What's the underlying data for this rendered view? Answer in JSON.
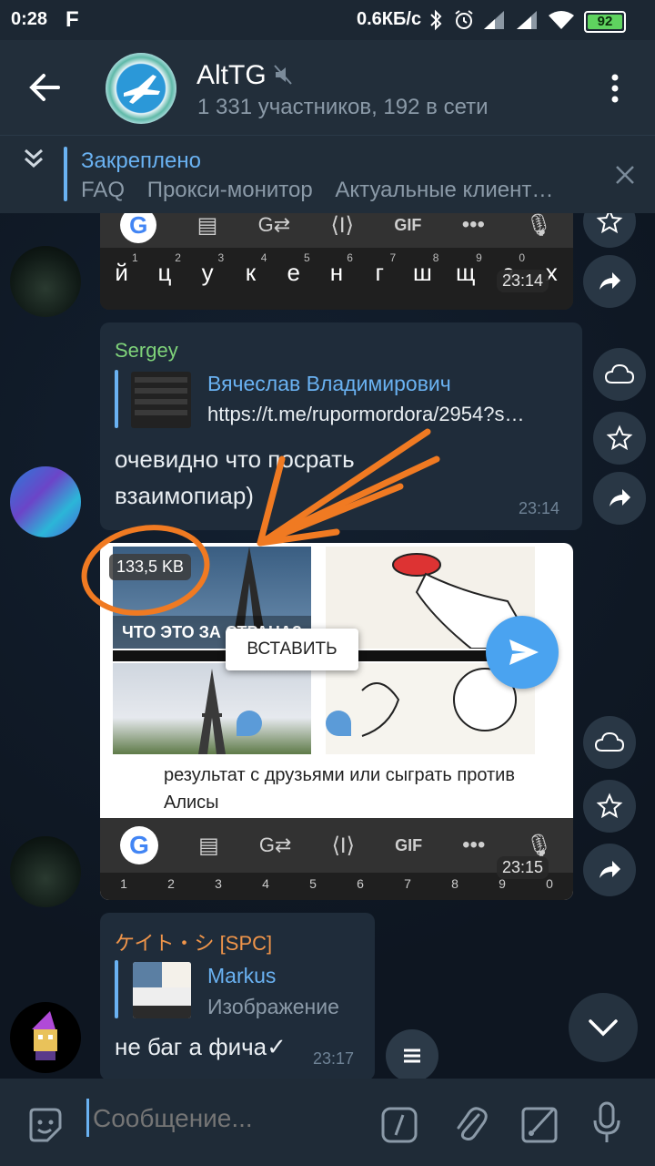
{
  "status": {
    "time": "0:28",
    "app_glyph": "F",
    "net_speed": "0.6КБ/с",
    "battery": "92"
  },
  "header": {
    "title": "AltTG",
    "subtitle": "1 331 участников, 192 в сети"
  },
  "pinned": {
    "label": "Закреплено",
    "items": [
      "FAQ",
      "Прокси-монитор",
      "Актуальные клиент…"
    ]
  },
  "msg1": {
    "time": "23:14",
    "toolbar_gif": "GIF",
    "keys": [
      "й",
      "ц",
      "у",
      "к",
      "е",
      "н",
      "г",
      "ш",
      "щ",
      "з",
      "х"
    ],
    "key_nums": [
      "1",
      "2",
      "3",
      "4",
      "5",
      "6",
      "7",
      "8",
      "9",
      "0"
    ]
  },
  "msg2": {
    "author": "Sergey",
    "reply_author": "Вячеслав Владимирович",
    "reply_text": "https://t.me/rupormordora/2954?s…",
    "text": "очевидно что посрать взаимопиар)",
    "time": "23:14"
  },
  "msg3": {
    "size_badge": "133,5 KB",
    "meme_caption": "ЧТО ЭТО ЗА СТРАНА?",
    "paste_label": "ВСТАВИТЬ",
    "alice_text": "результат с друзьями или сыграть против Алисы",
    "toolbar_gif": "GIF",
    "key_nums": [
      "1",
      "2",
      "3",
      "4",
      "5",
      "6",
      "7",
      "8",
      "9",
      "0"
    ],
    "time": "23:15"
  },
  "msg4": {
    "author": "ケイト・シ [SPC]",
    "reply_author": "Markus",
    "reply_text": "Изображение",
    "text": "не баг а фича✓",
    "time": "23:17"
  },
  "input": {
    "placeholder": "Сообщение..."
  },
  "colors": {
    "accent": "#6ab2f2",
    "sergey": "#7fd37a",
    "kate": "#f0954a",
    "annotation": "#f07a22"
  }
}
